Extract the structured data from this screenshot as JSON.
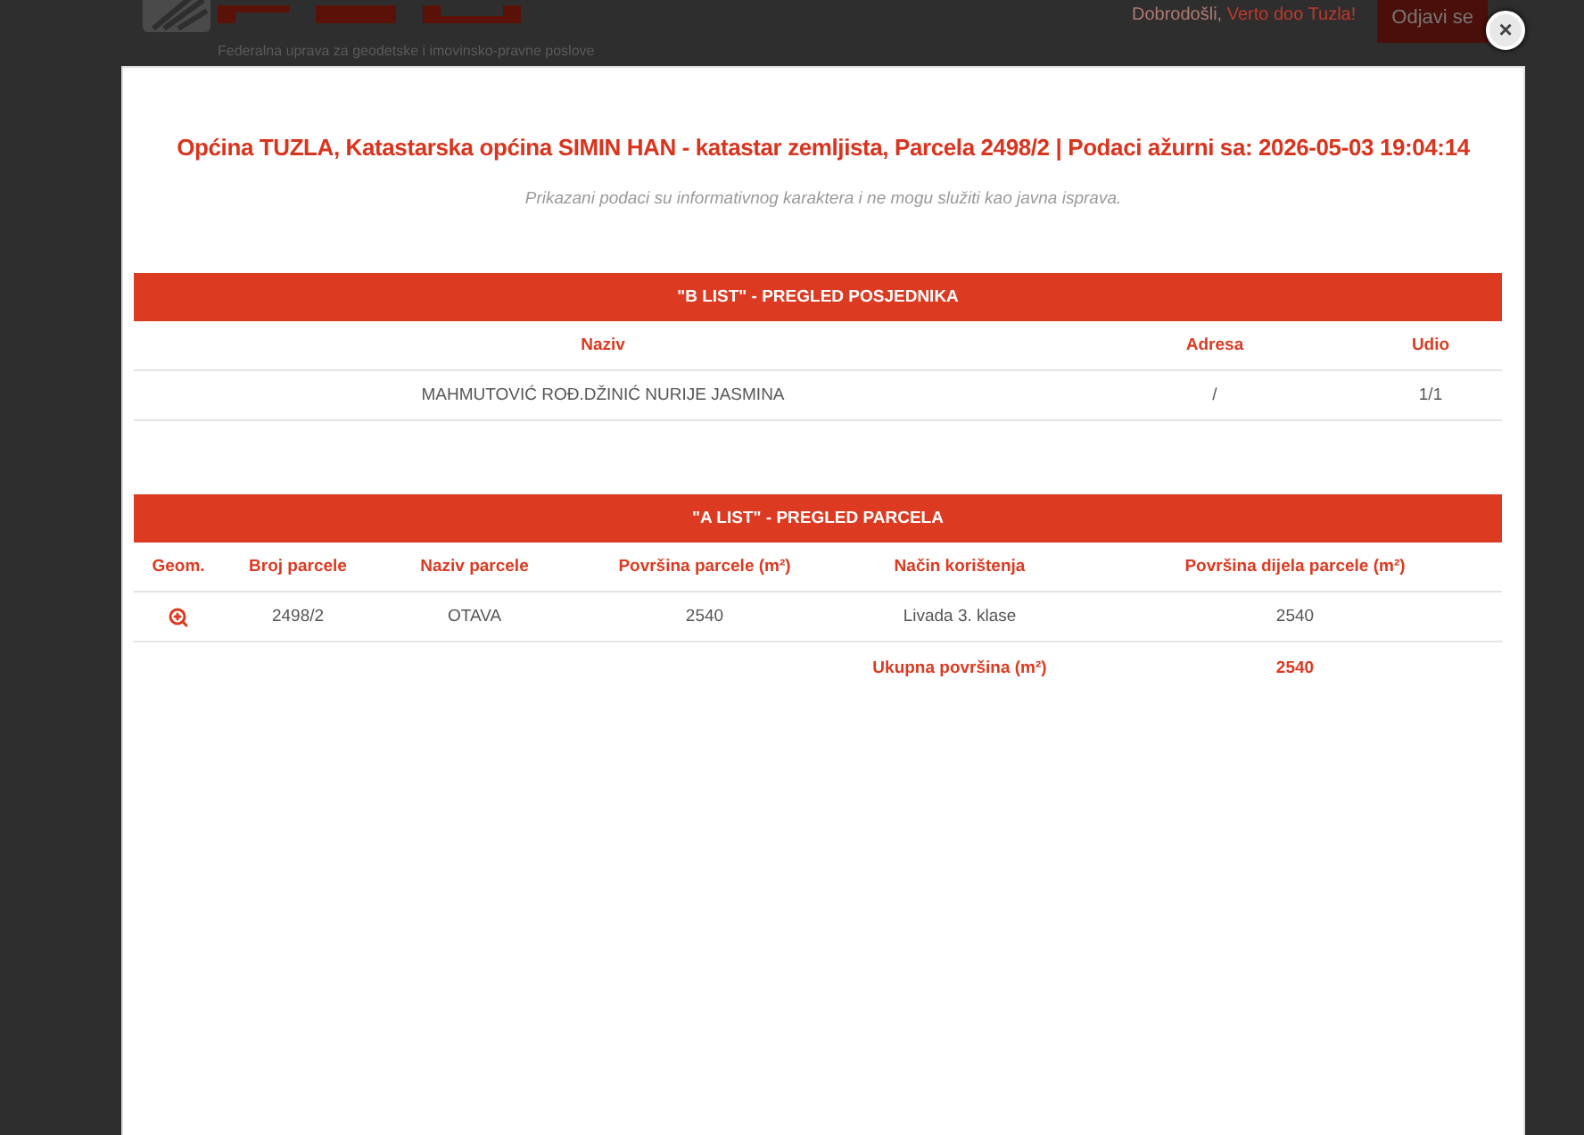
{
  "page_header": {
    "agency": "Federalna uprava za geodetske i imovinsko-pravne poslove",
    "greeting": "Dobrodošli,",
    "user": "Verto doo Tuzla!",
    "logout_button": "Odjavi se"
  },
  "dialog": {
    "close_button": "×",
    "title": "Općina TUZLA, Katastarska općina SIMIN HAN - katastar zemljista, Parcela 2498/2 | Podaci ažurni sa: 2026-05-03 19:04:14",
    "notice": "Prikazani podaci su informativnog karaktera i ne mogu služiti kao javna isprava.",
    "b_list": {
      "title": "\"B LIST\" - PREGLED POSJEDNIKA",
      "columns": [
        "Naziv",
        "Adresa",
        "Udio"
      ],
      "rows": [
        {
          "cells": [
            "MAHMUTOVIĆ ROĐ.DŽINIĆ NURIJE JASMINA",
            "/",
            "1/1"
          ]
        }
      ]
    },
    "a_list": {
      "title": "\"A LIST\" - PREGLED PARCELA",
      "columns": [
        "Geom.",
        "Broj parcele",
        "Naziv parcele",
        "Površina parcele (m²)",
        "Način korištenja",
        "Površina dijela parcele (m²)"
      ],
      "rows": [
        {
          "cells": [
            "",
            "2498/2",
            "OTAVA",
            "2540",
            "Livada 3. klase",
            "2540"
          ]
        }
      ],
      "total": {
        "label": "Ukupna površina (m²)",
        "value": "2540"
      }
    }
  }
}
